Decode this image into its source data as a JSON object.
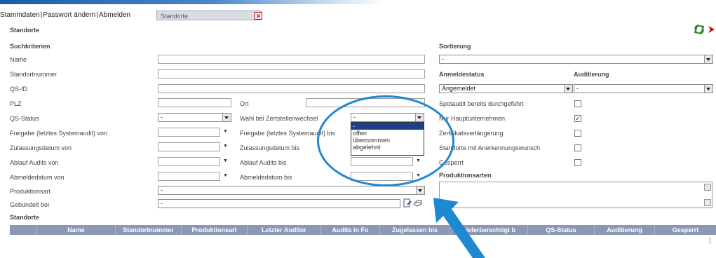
{
  "nav": {
    "stammdaten": "Stammdaten",
    "passwort": "Passwort ändern",
    "abmelden": "Abmelden"
  },
  "tab": {
    "label": "Standorte"
  },
  "page_title": "Standorte",
  "search": {
    "heading": "Suchkriterien",
    "name": "Name",
    "standortnummer": "Standortnummer",
    "qsid": "QS-ID",
    "plz": "PLZ",
    "ort": "Ort",
    "qsstatus": "QS-Status",
    "qsstatus_value": "-",
    "wahl": "Wahl bei Zertstellenwechsel",
    "wahl_value": "-",
    "freigabe_von": "Freigabe (letztes Systemaudit) von",
    "freigabe_bis": "Freigabe (letztes Systemaudit) bis",
    "zul_von": "Zulassungsdatum von",
    "zul_bis": "Zulassungsdatum bis",
    "ablauf_von": "Ablauf Audits von",
    "ablauf_bis": "Ablauf Audits bis",
    "abmelde_von": "Abmeldedatum von",
    "abmelde_bis": "Abmeldedatum bis",
    "produktionsart": "Produktionsart",
    "produktionsart_value": "-",
    "gebuendelt": "Gebündelt bei",
    "gebuendelt_value": "-",
    "dropdown_options": [
      "-",
      "offen",
      "übernommen",
      "abgelehnt"
    ]
  },
  "sort": {
    "heading": "Sortierung",
    "value": "-"
  },
  "anmelde": {
    "heading": "Anmeldestatus",
    "value": "Angemeldet"
  },
  "audit": {
    "heading": "Auditierung",
    "value": "-"
  },
  "checks": {
    "spotaudit": "Spotaudit bereits durchgeführt",
    "spotaudit_checked": false,
    "haupt": "Nur Hauptunternehmen",
    "haupt_checked": true,
    "zert": "Zertifikatsverlängerung",
    "zert_checked": false,
    "anerkennung": "Standorte mit Anerkennungswunsch",
    "anerkennung_checked": false,
    "gesperrt": "Gesperrt",
    "gesperrt_checked": false
  },
  "prod_heading": "Produktionsarten",
  "results": {
    "heading": "Standorte",
    "columns": [
      "Name",
      "Standortnummer",
      "Produktionsart",
      "Letzter Auditor",
      "Audits in Fo",
      "Zugelassen bis",
      "Lieferberechtigt b",
      "QS-Status",
      "Auditierung",
      "Gesperrt"
    ]
  },
  "colors": {
    "accent": "#1e88d0",
    "header": "#8a98b4",
    "selection": "#1f3f8e"
  }
}
